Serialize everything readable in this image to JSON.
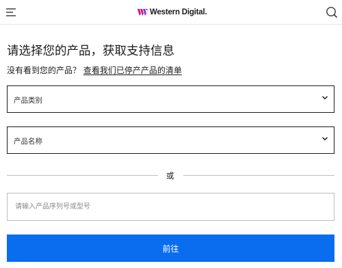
{
  "header": {
    "brand": "Western Digital.",
    "menu_icon": "hamburger-menu-icon",
    "search_icon": "search-icon",
    "logo_colors": [
      "#e4006b",
      "#8a2bd9"
    ]
  },
  "main": {
    "title": "请选择您的产品，获取支持信息",
    "subtitle_prefix": "没有看到您的产品？",
    "discontinued_link": "查看我们已停产产品的清单",
    "category_select": {
      "label": "产品类别"
    },
    "name_select": {
      "label": "产品名称"
    },
    "or_text": "或",
    "serial_input": {
      "placeholder": "请输入产品序列号或型号",
      "value": ""
    },
    "go_button": "前往"
  },
  "colors": {
    "primary_button": "#0a6df0",
    "text": "#1a1a1a"
  }
}
